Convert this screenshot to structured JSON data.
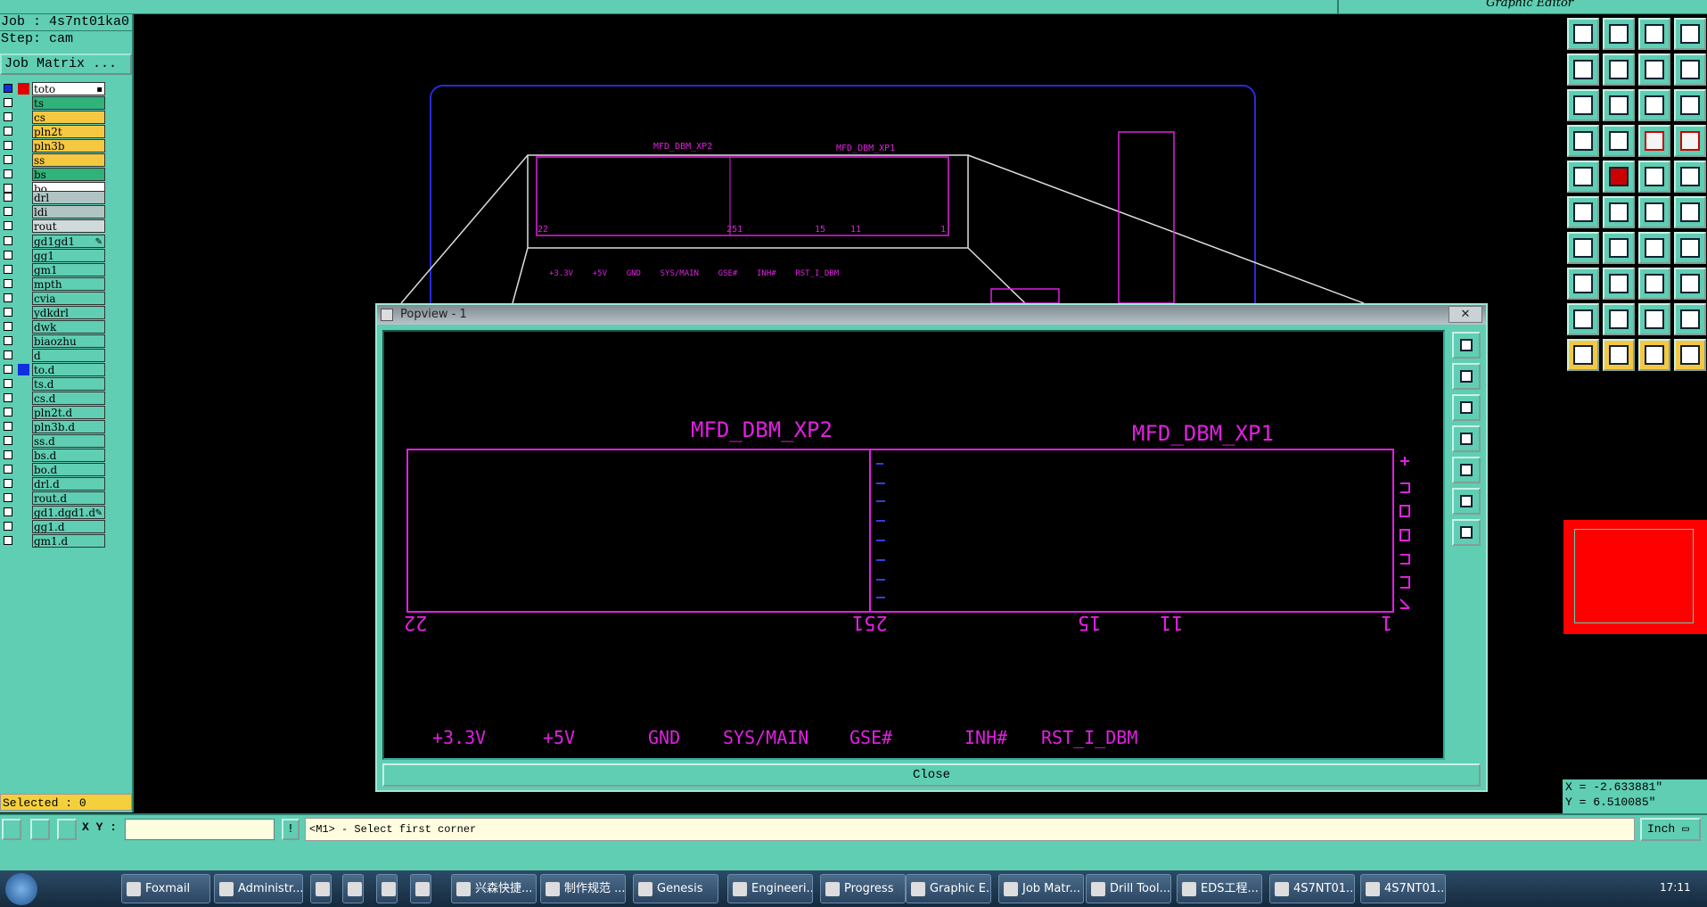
{
  "window": {
    "title": "Graphic Editor"
  },
  "job": {
    "job_label": "Job : 4s7nt01ka0",
    "step_label": "Step: cam",
    "job_matrix_button": "Job Matrix ..."
  },
  "layers": [
    {
      "name": "to",
      "color": "#ffffff",
      "swatch": "#e00000",
      "mark": "▪"
    },
    {
      "name": "ts",
      "color": "#2fb37b"
    },
    {
      "name": "cs",
      "color": "#f5c842"
    },
    {
      "name": "pln2t",
      "color": "#f5c842"
    },
    {
      "name": "pln3b",
      "color": "#f5c842"
    },
    {
      "name": "ss",
      "color": "#f5c842"
    },
    {
      "name": "bs",
      "color": "#2fb37b"
    },
    {
      "name": "bo",
      "color": "#ffffff"
    },
    {
      "name": "drl",
      "color": "#b0c4c4"
    },
    {
      "name": "ldi",
      "color": "#b0c4c4"
    },
    {
      "name": "rout",
      "color": "#d0dada"
    },
    {
      "name": "gd1",
      "color": "#5fceb3",
      "mark": "✎"
    },
    {
      "name": "gg1",
      "color": "#5fceb3"
    },
    {
      "name": "gm1",
      "color": "#5fceb3"
    },
    {
      "name": "mpth",
      "color": "#5fceb3"
    },
    {
      "name": "cvia",
      "color": "#5fceb3"
    },
    {
      "name": "ydkdrl",
      "color": "#5fceb3"
    },
    {
      "name": "dwk",
      "color": "#5fceb3"
    },
    {
      "name": "biaozhu",
      "color": "#5fceb3"
    },
    {
      "name": "d",
      "color": "#5fceb3"
    },
    {
      "name": "to.d",
      "color": "#5fceb3",
      "swatch": "#1030e0"
    },
    {
      "name": "ts.d",
      "color": "#5fceb3"
    },
    {
      "name": "cs.d",
      "color": "#5fceb3"
    },
    {
      "name": "pln2t.d",
      "color": "#5fceb3"
    },
    {
      "name": "pln3b.d",
      "color": "#5fceb3"
    },
    {
      "name": "ss.d",
      "color": "#5fceb3"
    },
    {
      "name": "bs.d",
      "color": "#5fceb3"
    },
    {
      "name": "bo.d",
      "color": "#5fceb3"
    },
    {
      "name": "drl.d",
      "color": "#5fceb3"
    },
    {
      "name": "rout.d",
      "color": "#5fceb3"
    },
    {
      "name": "gd1.d",
      "color": "#5fceb3",
      "mark": "✎"
    },
    {
      "name": "gg1.d",
      "color": "#5fceb3"
    },
    {
      "name": "gm1.d",
      "color": "#5fceb3"
    }
  ],
  "selected": "Selected : 0",
  "coords": {
    "x": "X = -2.633881\"",
    "y": "Y = 6.510085\""
  },
  "cmd": {
    "xy_label": "X Y :",
    "xy_value": "",
    "prompt": "<M1> - Select first corner",
    "units": "Inch"
  },
  "popview": {
    "title": "Popview - 1",
    "close_x": "✕",
    "close_button": "Close",
    "labels": {
      "xp2": "MFD_DBM_XP2",
      "xp1": "MFD_DBM_XP1",
      "n22": "22",
      "n251": "251",
      "n15": "15",
      "n11": "11",
      "n1": "1",
      "p33": "+3.3V",
      "p5": "+5V",
      "gnd": "GND",
      "sys": "SYS/MAIN",
      "gse": "GSE#",
      "inh": "INH#",
      "rst": "RST_I_DBM"
    }
  },
  "bg_labels": {
    "xp2": "MFD_DBM_XP2",
    "xp1": "MFD_DBM_XP1",
    "n22": "22",
    "n251": "251",
    "n15": "15",
    "n11": "11",
    "n1": "1",
    "row": "+3.3V    +5V    GND    SYS/MAIN    GSE#    INH#    RST_I_DBM"
  },
  "taskbar": {
    "items": [
      "Foxmail",
      "Administr...",
      "",
      "",
      "",
      "",
      "兴森快捷...",
      "制作规范 ...",
      "Genesis",
      "Engineeri...",
      "Progress",
      "Graphic E...",
      "Job Matr...",
      "Drill Tool...",
      "EDS工程...",
      "4S7NT01...",
      "4S7NT01..."
    ],
    "clock": "17:11"
  }
}
